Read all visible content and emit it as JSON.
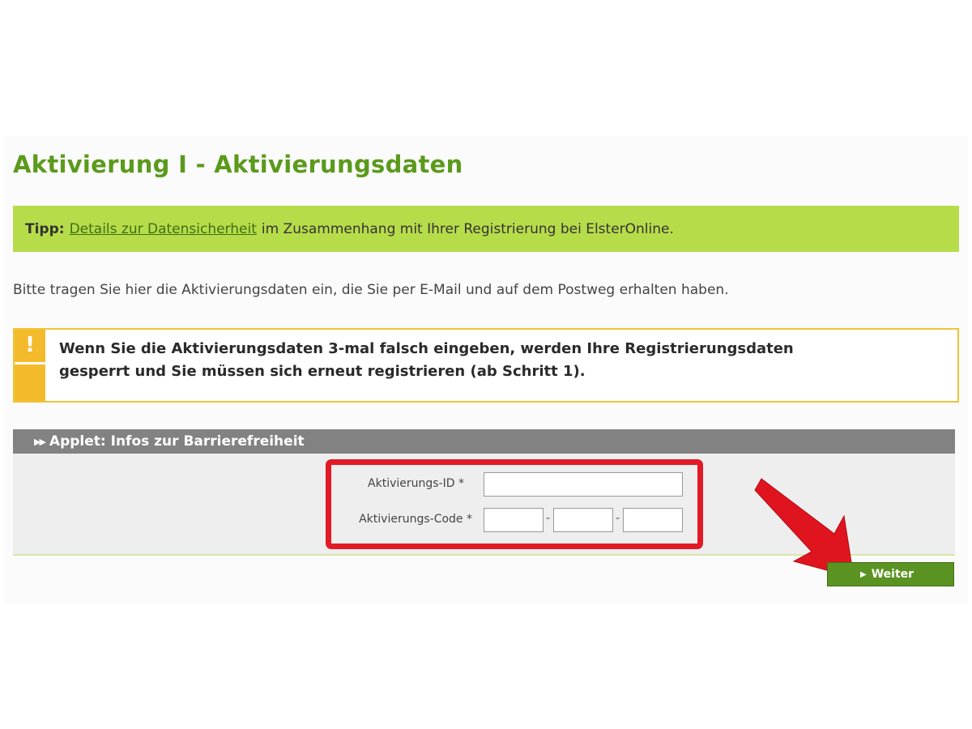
{
  "page": {
    "title": "Aktivierung I - Aktivierungsdaten"
  },
  "tip": {
    "prefix": "Tipp:",
    "link": "Details zur Datensicherheit",
    "text": "im Zusammenhang mit Ihrer Registrierung bei ElsterOnline."
  },
  "intro": "Bitte tragen Sie hier die Aktivierungsdaten ein, die Sie per E-Mail und auf dem Postweg erhalten haben.",
  "warning": {
    "icon": "exclamation-icon",
    "line1": "Wenn Sie die Aktivierungsdaten 3-mal falsch eingeben, werden Ihre Registrierungsdaten",
    "line2": "gesperrt und Sie müssen sich erneut registrieren (ab Schritt 1)."
  },
  "applet": {
    "label": "Applet: Infos zur Barrierefreiheit"
  },
  "form": {
    "id_label": "Aktivierungs-ID *",
    "code_label": "Aktivierungs-Code *",
    "id_value": "",
    "code_part1": "",
    "code_part2": "",
    "code_part3": "",
    "separator": "-"
  },
  "buttons": {
    "next": "Weiter"
  },
  "colors": {
    "title_green": "#5b9a1c",
    "tip_green": "#b7dc4a",
    "warning_yellow": "#f3bb2b",
    "applet_gray": "#828282",
    "highlight_red": "#e11a26",
    "button_green": "#5a9322"
  }
}
